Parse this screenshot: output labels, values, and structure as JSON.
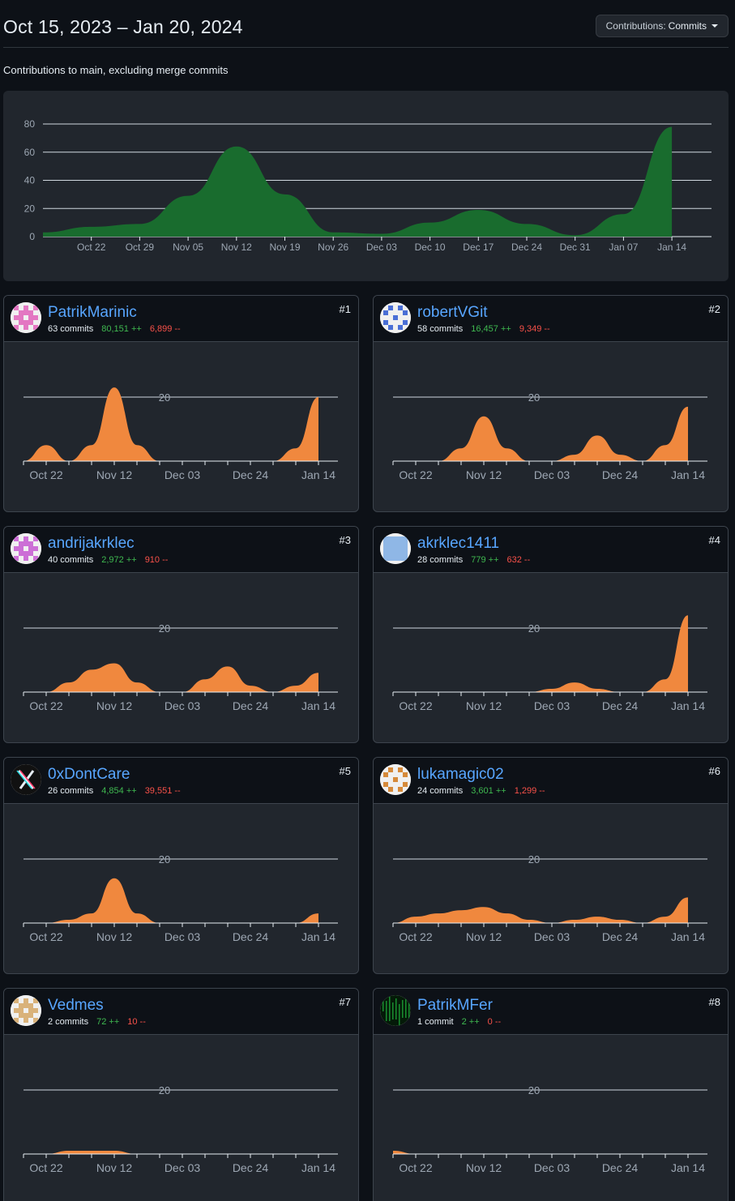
{
  "header": {
    "date_range": "Oct 15, 2023 – Jan 20, 2024",
    "contrib_label": "Contributions:",
    "contrib_value": "Commits"
  },
  "subtitle": "Contributions to main, excluding merge commits",
  "colors": {
    "main_area": "#196c2e",
    "contributor_area": "#f0883e",
    "link": "#58a6ff",
    "additions": "#3fb950",
    "deletions": "#f85149"
  },
  "chart_data": [
    {
      "type": "area",
      "title": "",
      "x": [
        "Oct 15",
        "Oct 22",
        "Oct 29",
        "Nov 05",
        "Nov 12",
        "Nov 19",
        "Nov 26",
        "Dec 03",
        "Dec 10",
        "Dec 17",
        "Dec 24",
        "Dec 31",
        "Jan 07",
        "Jan 14"
      ],
      "tick_labels": [
        "Oct 22",
        "Oct 29",
        "Nov 05",
        "Nov 12",
        "Nov 19",
        "Nov 26",
        "Dec 03",
        "Dec 10",
        "Dec 17",
        "Dec 24",
        "Dec 31",
        "Jan 07",
        "Jan 14"
      ],
      "series": [
        {
          "values": [
            3,
            7,
            9,
            29,
            64,
            30,
            3,
            2,
            10,
            19,
            9,
            1,
            16,
            78
          ]
        }
      ],
      "yticks": [
        0,
        20,
        40,
        60,
        80
      ],
      "ylim": [
        0,
        80
      ],
      "grid": true
    },
    {
      "type": "area",
      "x": [
        "Oct 15",
        "Oct 22",
        "Oct 29",
        "Nov 05",
        "Nov 12",
        "Nov 19",
        "Nov 26",
        "Dec 03",
        "Dec 10",
        "Dec 17",
        "Dec 24",
        "Dec 31",
        "Jan 07",
        "Jan 14"
      ],
      "tick_labels": [
        "Oct 22",
        "Nov 12",
        "Dec 03",
        "Dec 24",
        "Jan 14"
      ],
      "ytick": 20,
      "ylim": [
        0,
        20
      ],
      "grid": true,
      "contributors": [
        {
          "rank": "#1",
          "name": "PatrikMarinic",
          "commits": "63 commits",
          "additions": "80,151 ++",
          "deletions": "6,899 --",
          "avatar": "pink-identicon-icon",
          "values": [
            0,
            5,
            0,
            5,
            23,
            5,
            0,
            0,
            0,
            0,
            0,
            0,
            4,
            20
          ]
        },
        {
          "rank": "#2",
          "name": "robertVGit",
          "commits": "58 commits",
          "additions": "16,457 ++",
          "deletions": "9,349 --",
          "avatar": "blue-identicon-icon",
          "values": [
            0,
            0,
            0,
            4,
            14,
            4,
            0,
            0,
            2,
            8,
            2,
            0,
            5,
            17
          ]
        },
        {
          "rank": "#3",
          "name": "andrijakrklec",
          "commits": "40 commits",
          "additions": "2,972 ++",
          "deletions": "910 --",
          "avatar": "violet-identicon-icon",
          "values": [
            0,
            0,
            3,
            7,
            9,
            3,
            0,
            0,
            4,
            8,
            2,
            0,
            2,
            6
          ]
        },
        {
          "rank": "#4",
          "name": "akrklec1411",
          "commits": "28 commits",
          "additions": "779 ++",
          "deletions": "632 --",
          "avatar": "lightblue-identicon-icon",
          "values": [
            0,
            0,
            0,
            0,
            0,
            0,
            0,
            1,
            3,
            1,
            0,
            0,
            4,
            24
          ]
        },
        {
          "rank": "#5",
          "name": "0xDontCare",
          "commits": "26 commits",
          "additions": "4,854 ++",
          "deletions": "39,551 --",
          "avatar": "glitch-x-icon",
          "values": [
            0,
            0,
            1,
            3,
            14,
            3,
            0,
            0,
            0,
            0,
            0,
            0,
            0,
            3
          ]
        },
        {
          "rank": "#6",
          "name": "lukamagic02",
          "commits": "24 commits",
          "additions": "3,601 ++",
          "deletions": "1,299 --",
          "avatar": "orange-identicon-icon",
          "values": [
            0,
            2,
            3,
            4,
            5,
            3,
            1,
            0,
            1,
            2,
            1,
            0,
            2,
            8
          ]
        },
        {
          "rank": "#7",
          "name": "Vedmes",
          "commits": "2 commits",
          "additions": "72 ++",
          "deletions": "10 --",
          "avatar": "tan-identicon-icon",
          "values": [
            0,
            0,
            1,
            1,
            1,
            0,
            0,
            0,
            0,
            0,
            0,
            0,
            0,
            0
          ]
        },
        {
          "rank": "#8",
          "name": "PatrikMFer",
          "commits": "1 commit",
          "additions": "2 ++",
          "deletions": "0 --",
          "avatar": "matrix-code-icon",
          "values": [
            1,
            0,
            0,
            0,
            0,
            0,
            0,
            0,
            0,
            0,
            0,
            0,
            0,
            0
          ]
        }
      ]
    }
  ]
}
